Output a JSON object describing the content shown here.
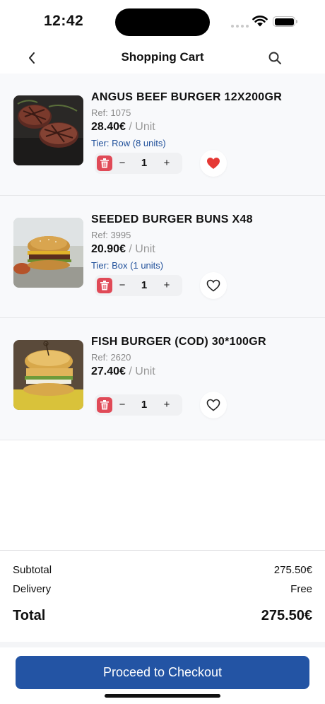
{
  "status": {
    "time": "12:42"
  },
  "nav": {
    "title": "Shopping Cart",
    "back_icon": "chevron-left-icon",
    "search_icon": "search-icon"
  },
  "items": [
    {
      "name": "ANGUS BEEF BURGER 12X200GR",
      "ref": "Ref: 1075",
      "price": "28.40€",
      "unit": " / Unit",
      "tier": "Tier: Row (8 units)",
      "qty": "1",
      "favorited": true
    },
    {
      "name": "SEEDED BURGER BUNS X48",
      "ref": "Ref: 3995",
      "price": "20.90€",
      "unit": " / Unit",
      "tier": "Tier: Box (1 units)",
      "qty": "1",
      "favorited": false
    },
    {
      "name": "FISH BURGER (COD) 30*100GR",
      "ref": "Ref: 2620",
      "price": "27.40€",
      "unit": " / Unit",
      "tier": "",
      "qty": "1",
      "favorited": false
    }
  ],
  "qty_controls": {
    "minus": "−",
    "plus": "+"
  },
  "summary": {
    "subtotal_label": "Subtotal",
    "subtotal_value": "275.50€",
    "delivery_label": "Delivery",
    "delivery_value": "Free",
    "total_label": "Total",
    "total_value": "275.50€"
  },
  "checkout": {
    "label": "Proceed to Checkout"
  },
  "colors": {
    "accent": "#2354a4",
    "danger": "#e04a57",
    "tier": "#1f4f9a",
    "heart": "#e53935"
  }
}
